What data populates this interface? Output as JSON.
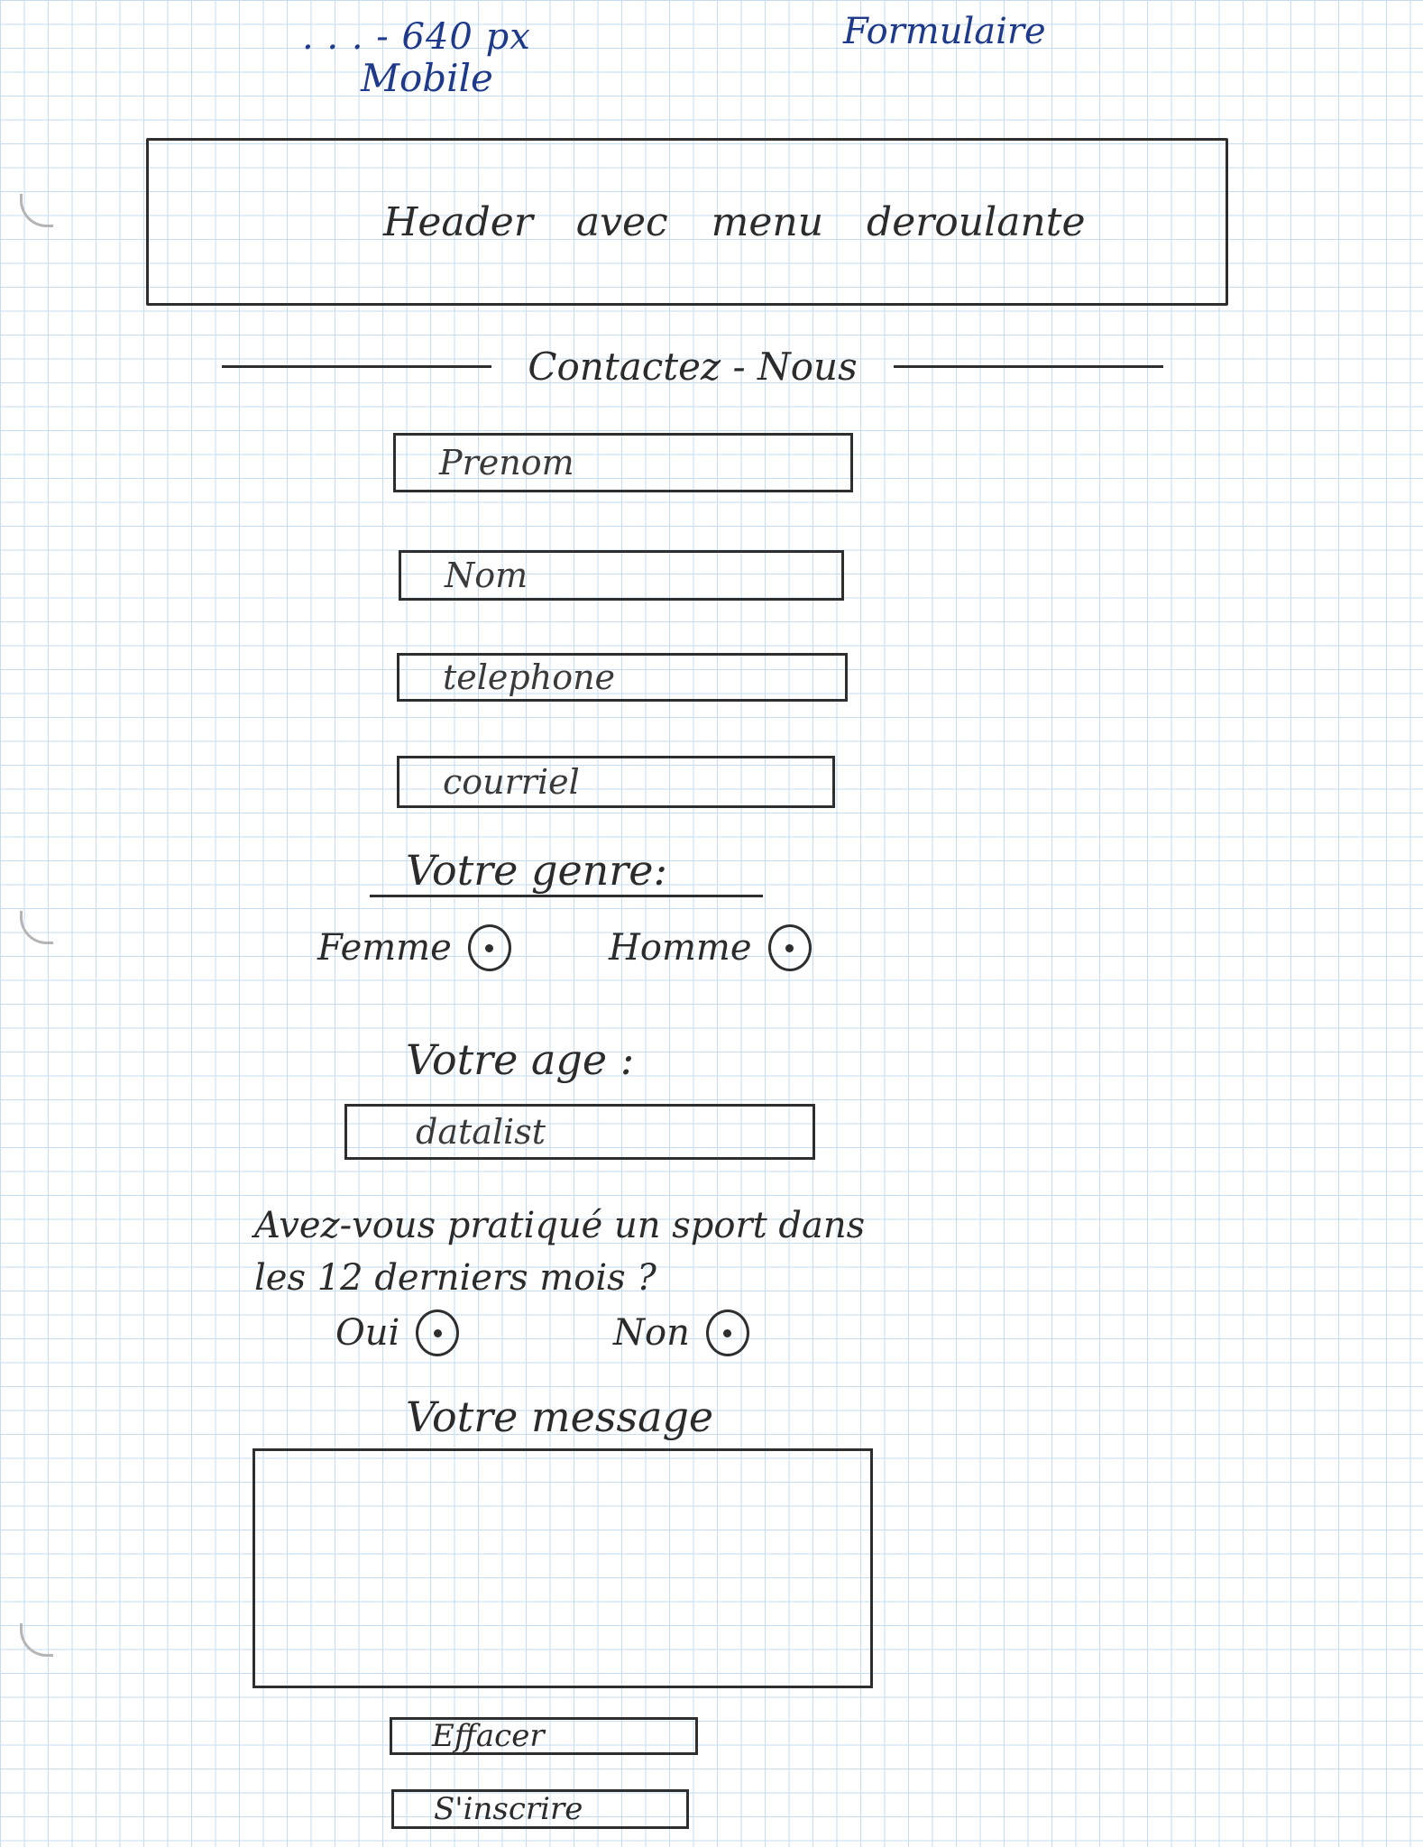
{
  "notes": {
    "size": ". . . - 640 px",
    "device": "Mobile",
    "page_type": "Formulaire"
  },
  "header": {
    "label": "Header avec menu deroulante"
  },
  "form": {
    "title": "Contactez - Nous",
    "fields": {
      "prenom": "Prenom",
      "nom": "Nom",
      "telephone": "telephone",
      "courriel": "courriel"
    },
    "genre": {
      "label": "Votre genre:",
      "options": [
        "Femme",
        "Homme"
      ]
    },
    "age": {
      "label": "Votre age :",
      "placeholder": "datalist"
    },
    "sport": {
      "question": "Avez-vous pratiqué un sport dans les 12 derniers mois ?",
      "options": [
        "Oui",
        "Non"
      ]
    },
    "message": {
      "label": "Votre message"
    },
    "buttons": {
      "reset": "Effacer",
      "submit": "S'inscrire"
    }
  },
  "colors": {
    "grid": "#c6dcef",
    "pencil": "#2e2e2e",
    "ink_blue": "#1f3a8a"
  }
}
